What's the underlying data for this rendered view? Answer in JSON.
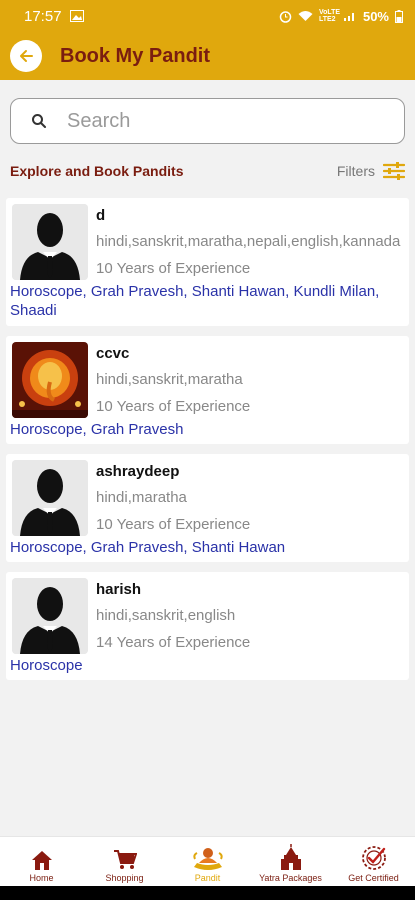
{
  "status": {
    "time": "17:57",
    "battery": "50%",
    "network": "VoLTE LTE2"
  },
  "app_bar": {
    "title": "Book My Pandit"
  },
  "search": {
    "placeholder": "Search"
  },
  "explore": {
    "title": "Explore and Book Pandits",
    "filters_label": "Filters"
  },
  "pandits": [
    {
      "name": "d",
      "languages": "hindi,sanskrit,maratha,nepali,english,kannada",
      "experience": "10 Years of Experience",
      "services": "Horoscope, Grah Pravesh, Shanti Hawan, Kundli Milan, Shaadi",
      "avatar": "person-silhouette-icon"
    },
    {
      "name": "ccvc",
      "languages": "hindi,sanskrit,maratha",
      "experience": "10 Years of Experience",
      "services": "Horoscope, Grah Pravesh",
      "avatar": "ganesha-image"
    },
    {
      "name": "ashraydeep",
      "languages": "hindi,maratha",
      "experience": "10 Years of Experience",
      "services": "Horoscope, Grah Pravesh, Shanti Hawan",
      "avatar": "person-silhouette-icon"
    },
    {
      "name": "harish",
      "languages": "hindi,sanskrit,english",
      "experience": "14 Years of Experience",
      "services": "Horoscope",
      "avatar": "person-silhouette-icon"
    }
  ],
  "nav": [
    {
      "label": "Home",
      "icon": "home-icon"
    },
    {
      "label": "Shopping",
      "icon": "cart-icon"
    },
    {
      "label": "Pandit",
      "icon": "pandit-icon",
      "active": true
    },
    {
      "label": "Yatra Packages",
      "icon": "temple-icon"
    },
    {
      "label": "Get Certified",
      "icon": "certificate-icon"
    }
  ],
  "colors": {
    "brand": "#e0a80d",
    "title": "#7a1d10",
    "link": "#2a32a8",
    "muted": "#888888"
  }
}
